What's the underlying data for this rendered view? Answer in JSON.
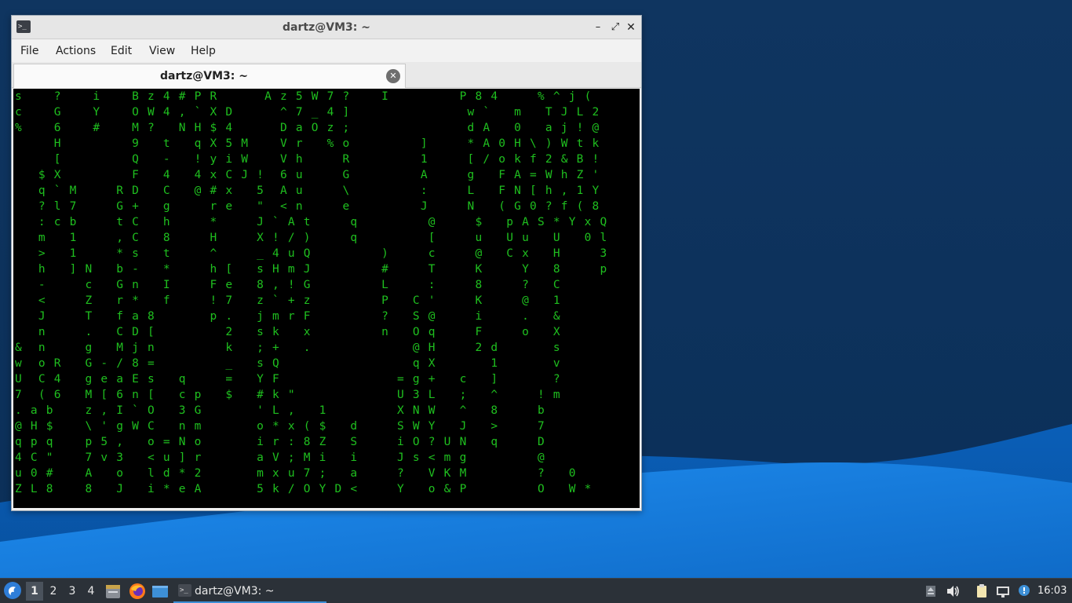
{
  "window": {
    "title": "dartz@VM3: ~",
    "menu": [
      "File",
      "Actions",
      "Edit",
      "View",
      "Help"
    ],
    "tab_label": "dartz@VM3: ~",
    "terminal_lines": [
      "s    ?    i    B z 4 # P R      A z 5 W 7 ?    I         P 8 4     % ^ j (",
      "c    G    Y    O W 4 , ` X D      ^ 7 _ 4 ]               w `   m   T J L 2",
      "%    6    #    M ?   N H $ 4      D a O z ;               d A   0   a j ! @",
      "     H         9   t   q X 5 M    V r   % o         ]     * A 0 H \\ ) W t k",
      "     [         Q   -   ! y i W    V h     R         1     [ / o k f 2 & B !",
      "   $ X         F   4   4 x C J !  6 u     G         A     g   F A = W h Z '",
      "   q ` M     R D   C   @ # x   5  A u     \\         :     L   F N [ h , 1 Y",
      "   ? l 7     G +   g     r e   \"  < n     e         J     N   ( G 0 ? f ( 8",
      "   : c b     t C   h     *     J ` A t     q         @     $   p A S * Y x Q",
      "   m   1     , C   8     H     X ! / )     q         [     u   U u   U   0 l",
      "   >   1     * s   t     ^     _ 4 u Q         )     c     @   C x   H     3",
      "   h   ] N   b -   *     h [   s H m J         #     T     K     Y   8     p",
      "   -     c   G n   I     F e   8 , ! G         L     :     8     ?   C",
      "   <     Z   r *   f     ! 7   z ` + z         P   C '     K     @   1",
      "   J     T   f a 8       p .   j m r F         ?   S @     i     .   &",
      "   n     .   C D [         2   s k   x         n   O q     F     o   X",
      "&  n     g   M j n         k   ; +   .             @ H     2 d       s",
      "w  o R   G - / 8 =         _   s Q                 q X       1       v",
      "U  C 4   g e a E s   q     =   Y F               = g +   c   ]       ?",
      "7  ( 6   M [ 6 n [   c p   $   # k \"             U 3 L   ;   ^     ! m",
      ". a b    z , I ` O   3 G       ' L ,   1         X N W   ^   8     b",
      "@ H $    \\ ' g W C   n m       o * x ( $   d     S W Y   J   >     7",
      "q p q    p 5 ,   o = N o       i r : 8 Z   S     i O ? U N   q     D",
      "4 C \"    7 v 3   < u ] r       a V ; M i   i     J s < m g         @",
      "u 0 #    A   o   l d * 2       m x u 7 ;   a     ?   V K M         ?   0",
      "Z L 8    8   J   i * e A       5 k / O Y D <     Y   o & P         O   W *"
    ]
  },
  "taskbar": {
    "workspaces": [
      "1",
      "2",
      "3",
      "4"
    ],
    "active_workspace": "1",
    "launchers": [
      "file-manager-icon",
      "firefox-icon",
      "show-desktop-icon"
    ],
    "task_label": "dartz@VM3: ~",
    "tray": [
      "eject-icon",
      "volume-icon",
      "clipboard-icon",
      "network-icon",
      "notification-icon"
    ],
    "clock": "16:03"
  },
  "colors": {
    "desktop_dark": "#0e3a6a",
    "desktop_wave": "#1a7fd6",
    "terminal_bg": "#000000",
    "terminal_fg": "#1fbf1f",
    "taskbar_bg": "#2b3138",
    "accent": "#3d8fd6"
  }
}
